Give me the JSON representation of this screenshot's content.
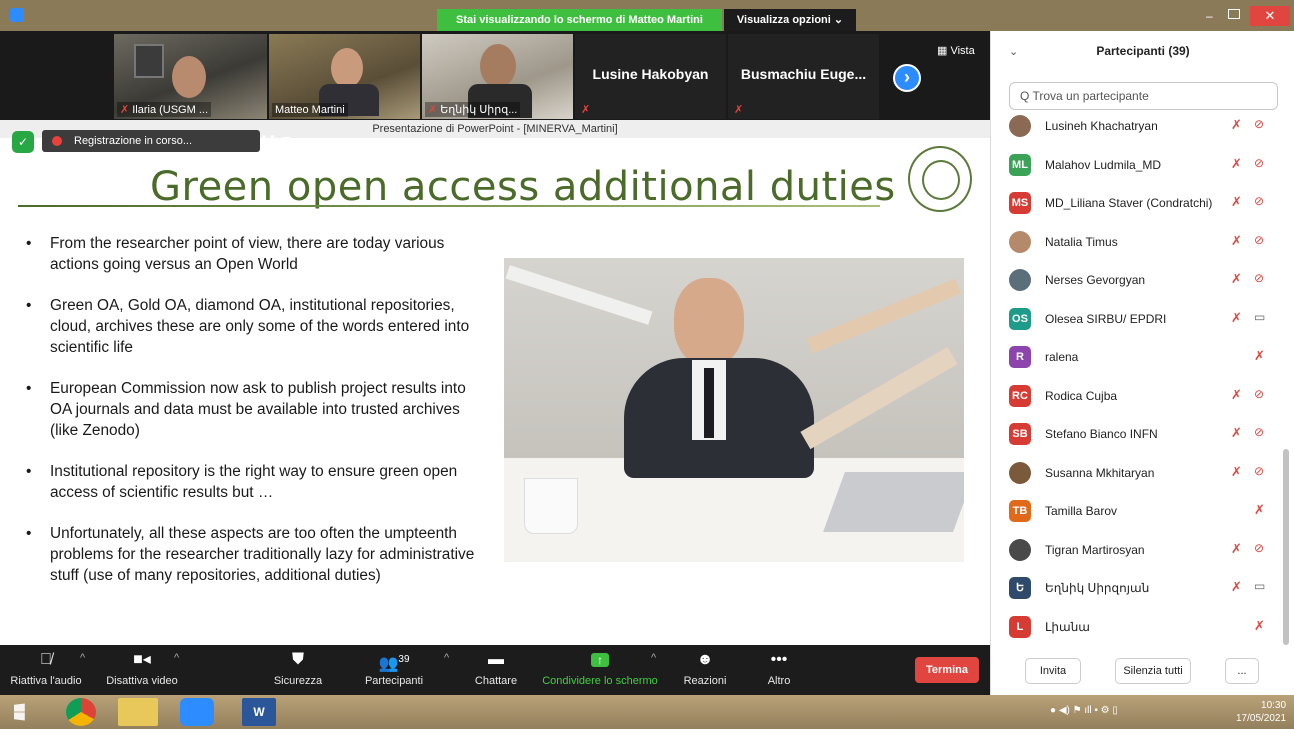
{
  "window": {
    "share_banner": "Stai visualizzando lo schermo di Matteo Martini",
    "view_options": "Visualizza opzioni ⌄",
    "vista": "▦ Vista"
  },
  "video_tiles": [
    {
      "name": "Ilaria (USGM ..."
    },
    {
      "name": "Matteo Martini"
    },
    {
      "name": "Եղնիկ Սիրզ..."
    },
    {
      "name": "Lusine Hakobyan"
    },
    {
      "name": "Busmachiu Euge..."
    }
  ],
  "slide": {
    "window_title": "Presentazione di PowerPoint - [MINERVA_Martini]",
    "recording_label": "Registrazione in corso...",
    "title": "Green open access additional duties",
    "bullets": [
      "From the researcher point of view, there are today various actions going versus an Open World",
      "Green OA, Gold OA, diamond OA, institutional repositories, cloud, archives these are only some of the words entered into scientific life",
      "European Commission now ask to publish project results into OA journals and data must be available into trusted archives (like Zenodo)",
      "Institutional repository is the right way to ensure green open access of scientific results but …",
      "Unfortunately, all these aspects are too often the umpteenth problems for the researcher traditionally lazy for administrative stuff (use of many repositories, additional duties)"
    ]
  },
  "toolbar": {
    "audio": "Riattiva l'audio",
    "video": "Disattiva video",
    "security": "Sicurezza",
    "participants": "Partecipanti",
    "participants_count": "39",
    "chat": "Chattare",
    "share": "Condividere lo schermo",
    "reactions": "Reazioni",
    "more": "Altro",
    "end": "Termina"
  },
  "panel": {
    "title": "Partecipanti (39)",
    "search_placeholder": "Q Trova un partecipante",
    "invite": "Invita",
    "mute_all": "Silenzia tutti",
    "more": "..."
  },
  "participants": [
    {
      "initials": "",
      "name": "Lusineh Khachatryan",
      "color": "#8a6a55",
      "photo": true,
      "cam": "off"
    },
    {
      "initials": "ML",
      "name": "Malahov  Ludmila_MD",
      "color": "#3aa357",
      "photo": false,
      "cam": "off"
    },
    {
      "initials": "MS",
      "name": "MD_Liliana Staver (Condratchi)",
      "color": "#d63b34",
      "photo": false,
      "cam": "off"
    },
    {
      "initials": "",
      "name": "Natalia Timus",
      "color": "#b58a6a",
      "photo": true,
      "cam": "off"
    },
    {
      "initials": "",
      "name": "Nerses Gevorgyan",
      "color": "#5a6f7a",
      "photo": true,
      "cam": "off"
    },
    {
      "initials": "OS",
      "name": "Olesea SIRBU/ EPDRI",
      "color": "#1f9b8a",
      "photo": false,
      "cam": "on"
    },
    {
      "initials": "R",
      "name": "ralena",
      "color": "#8e44ad",
      "photo": false,
      "cam": "none"
    },
    {
      "initials": "RC",
      "name": "Rodica Cujba",
      "color": "#d63b34",
      "photo": false,
      "cam": "off"
    },
    {
      "initials": "SB",
      "name": "Stefano Bianco INFN",
      "color": "#d63b34",
      "photo": false,
      "cam": "off"
    },
    {
      "initials": "",
      "name": "Susanna Mkhitaryan",
      "color": "#7a5a3a",
      "photo": true,
      "cam": "off"
    },
    {
      "initials": "TB",
      "name": "Tamilla Barov",
      "color": "#e06a1a",
      "photo": false,
      "cam": "none"
    },
    {
      "initials": "",
      "name": "Tigran Martirosyan",
      "color": "#4a4a4a",
      "photo": true,
      "cam": "off"
    },
    {
      "initials": "Ե",
      "name": "Եղնիկ Սիրզոյան",
      "color": "#2f4a6a",
      "photo": false,
      "cam": "on"
    },
    {
      "initials": "L",
      "name": "Լիանա",
      "color": "#d63b34",
      "photo": false,
      "cam": "none"
    }
  ],
  "taskbar": {
    "time": "10:30",
    "date": "17/05/2021"
  }
}
